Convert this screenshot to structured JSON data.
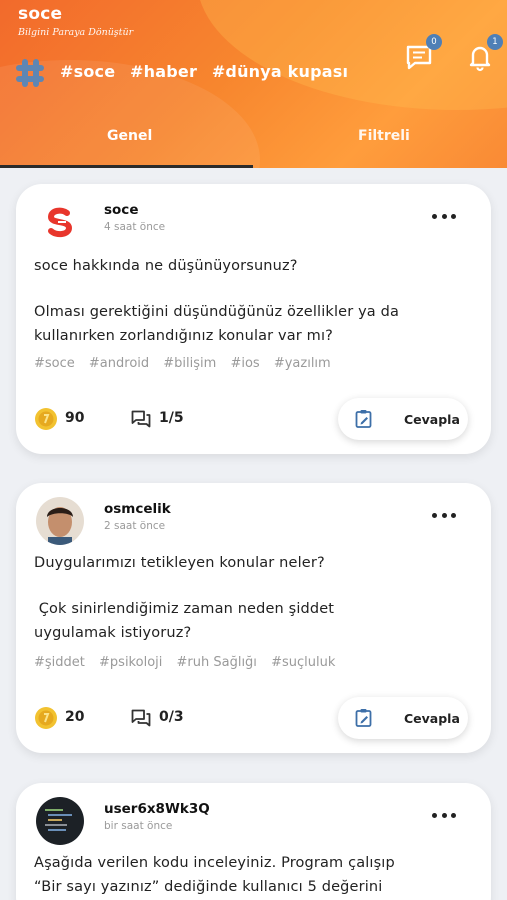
{
  "app": {
    "name": "soce",
    "slogan": "Bilgini Paraya Dönüştür"
  },
  "header": {
    "trending_tags": [
      "#soce",
      "#haber",
      "#dünya kupası"
    ],
    "messages_count": "0",
    "notifications_count": "1"
  },
  "tabs": [
    {
      "label": "Genel",
      "active": true
    },
    {
      "label": "Filtreli",
      "active": false
    }
  ],
  "colors": {
    "header_orange": "#f7862e",
    "badge_blue": "#4f7fb6",
    "coin_gold": "#f2c230",
    "edit_icon_blue": "#3d6fa8"
  },
  "posts": [
    {
      "user": "soce",
      "time": "4 saat önce",
      "avatar": "soce-logo-icon",
      "text_line1": "soce hakkında ne düşünüyorsunuz?",
      "text_line2": "Olması gerektiğini düşündüğünüz özellikler ya da kullanırken zorlandığınız konular var mı?",
      "tags": [
        "#soce",
        "#android",
        "#bilişim",
        "#ios",
        "#yazılım"
      ],
      "coins": "90",
      "answers": "1/5",
      "reply_label": "Cevapla"
    },
    {
      "user": "osmcelik",
      "time": "2 saat önce",
      "avatar": "user-photo",
      "text_line1": "Duygularımızı tetikleyen konular neler?",
      "text_line2": " Çok sinirlendiğimiz zaman neden şiddet uygulamak istiyoruz?",
      "tags": [
        "#şiddet",
        "#psikoloji",
        "#ruh Sağlığı",
        "#suçluluk"
      ],
      "coins": "20",
      "answers": "0/3",
      "reply_label": "Cevapla"
    },
    {
      "user": "user6x8Wk3Q",
      "time": "bir saat önce",
      "avatar": "code-screen-photo",
      "text_line1": "Aşağıda verilen kodu inceleyiniz. Program çalışıp",
      "text_line2": "“Bir sayı yazınız” dediğinde kullanıcı 5 değerini"
    }
  ]
}
